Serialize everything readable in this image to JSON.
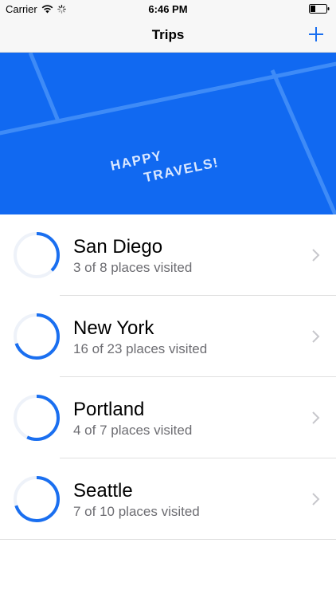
{
  "status_bar": {
    "carrier": "Carrier",
    "time": "6:46 PM",
    "icons": [
      "wifi-icon",
      "activity-spinner-icon",
      "battery-icon"
    ]
  },
  "nav": {
    "title": "Trips",
    "add_icon": "plus-icon"
  },
  "banner": {
    "line1": "HAPPY",
    "line2": "TRAVELS!",
    "background_color": "#1169f1",
    "text_color": "#ffffff"
  },
  "trips": [
    {
      "name": "San Diego",
      "subtitle": "3 of 8 places visited",
      "visited": 3,
      "total": 8
    },
    {
      "name": "New York",
      "subtitle": "16 of 23 places visited",
      "visited": 16,
      "total": 23
    },
    {
      "name": "Portland",
      "subtitle": "4 of 7 places visited",
      "visited": 4,
      "total": 7
    },
    {
      "name": "Seattle",
      "subtitle": "7 of 10 places visited",
      "visited": 7,
      "total": 10
    }
  ],
  "colors": {
    "accent": "#1a6ff0",
    "ring_track": "#eef2f9",
    "subtitle": "#6d6d72",
    "chevron": "#c7c7cc"
  }
}
